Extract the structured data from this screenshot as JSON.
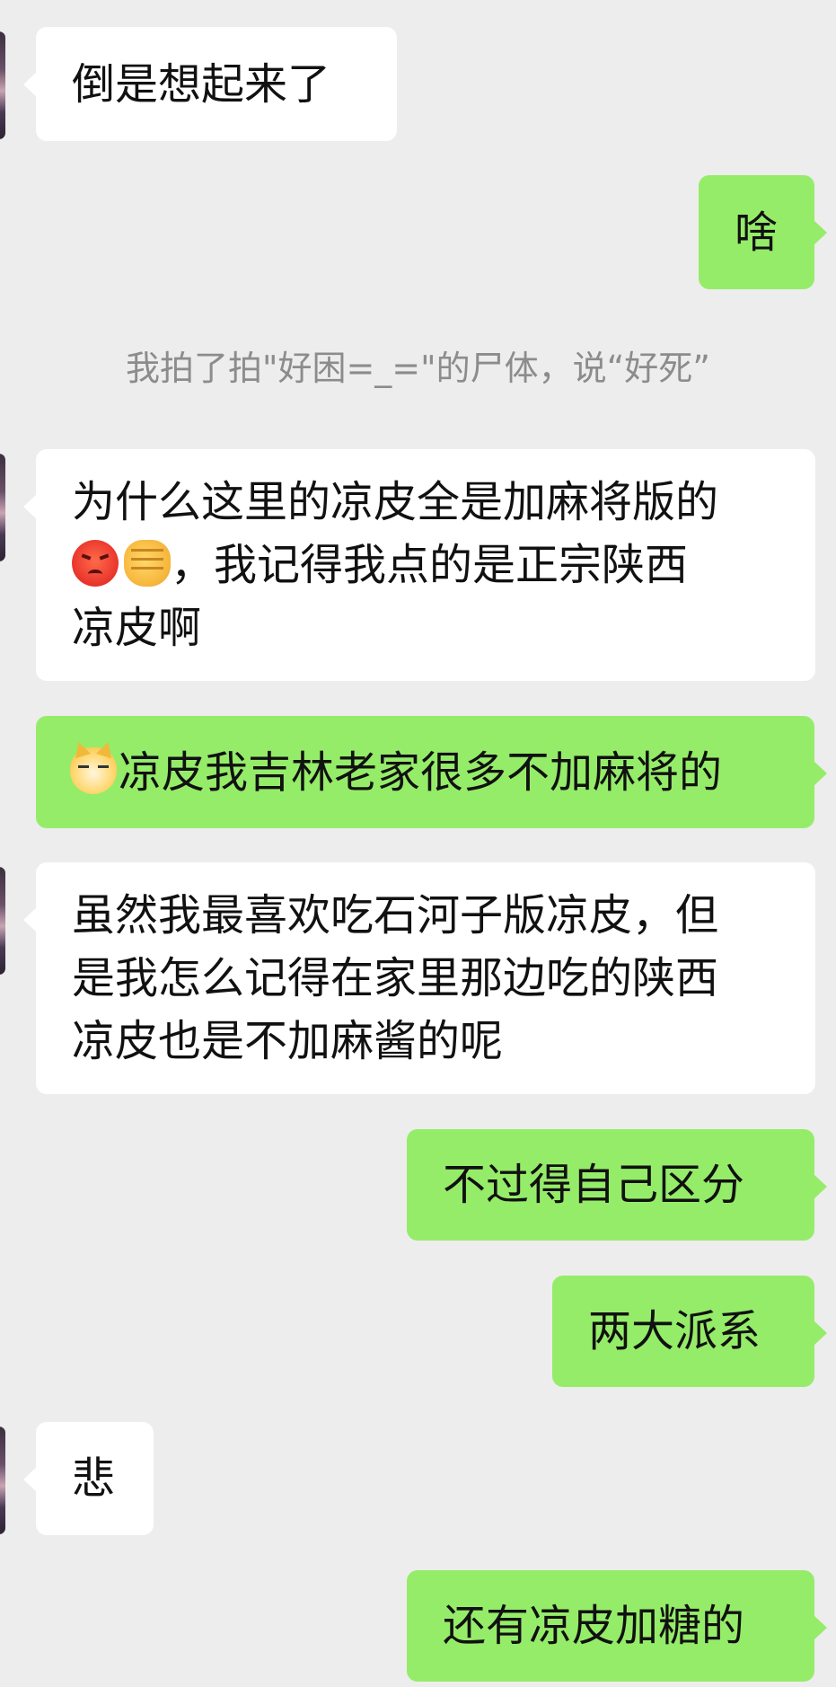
{
  "chat": {
    "messages": [
      {
        "side": "in",
        "lines": [
          "倒是想起来了"
        ]
      },
      {
        "side": "out",
        "lines": [
          "啥"
        ]
      },
      {
        "system": "我拍了拍\"好困=_=\"的尸体，说“好死”"
      },
      {
        "side": "in",
        "lines": [
          "为什么这里的凉皮全是加麻将版的",
          "，我记得我点的是正宗陕西",
          "凉皮啊"
        ],
        "emoji": [
          "angry-face-emoji",
          "fist-emoji"
        ]
      },
      {
        "side": "out",
        "lines": [
          "凉皮我吉林老家很多不加麻将的"
        ],
        "emoji": [
          "cat-face-emoji"
        ]
      },
      {
        "side": "in",
        "lines": [
          "虽然我最喜欢吃石河子版凉皮，但",
          "是我怎么记得在家里那边吃的陕西",
          "凉皮也是不加麻酱的呢"
        ]
      },
      {
        "side": "out",
        "lines": [
          "不过得自己区分"
        ]
      },
      {
        "side": "out",
        "lines": [
          "两大派系"
        ]
      },
      {
        "side": "in",
        "lines": [
          "悲"
        ]
      },
      {
        "side": "out",
        "lines": [
          "还有凉皮加糖的"
        ]
      }
    ]
  },
  "colors": {
    "background": "#ededed",
    "incoming_bubble": "#ffffff",
    "outgoing_bubble": "#95ec69",
    "system_text": "#8c8c8c"
  }
}
